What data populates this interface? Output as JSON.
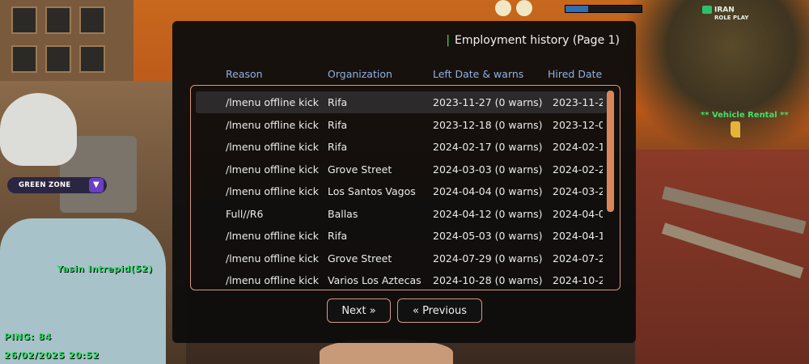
{
  "hud": {
    "brand": [
      "IRAN",
      "ROLE PLAY"
    ],
    "health_fraction": 0.3,
    "vehicle_rental_label": "**  Vehicle Rental **",
    "zone_label": "GREEN ZONE",
    "player_name": "Yasin Intrepid(52)",
    "ping": "PING: 84",
    "datetime": "26/02/2025 20:52"
  },
  "dialog": {
    "title": "Employment history (Page 1)",
    "columns": [
      "Reason",
      "Organization",
      "Left Date & warns",
      "Hired Date"
    ],
    "rows": [
      {
        "reason": "/lmenu offline kick",
        "organization": "Rifa",
        "left": "2023-11-27 (0 warns)",
        "hired": "2023-11-2"
      },
      {
        "reason": "/lmenu offline kick",
        "organization": "Rifa",
        "left": "2023-12-18 (0 warns)",
        "hired": "2023-12-0"
      },
      {
        "reason": "/lmenu offline kick",
        "organization": "Rifa",
        "left": "2024-02-17 (0 warns)",
        "hired": "2024-02-1"
      },
      {
        "reason": "/lmenu offline kick",
        "organization": "Grove Street",
        "left": "2024-03-03 (0 warns)",
        "hired": "2024-02-2"
      },
      {
        "reason": "/lmenu offline kick",
        "organization": "Los Santos Vagos",
        "left": "2024-04-04 (0 warns)",
        "hired": "2024-03-2"
      },
      {
        "reason": "Full//R6",
        "organization": "Ballas",
        "left": "2024-04-12 (0 warns)",
        "hired": "2024-04-0"
      },
      {
        "reason": "/lmenu offline kick",
        "organization": "Rifa",
        "left": "2024-05-03 (0 warns)",
        "hired": "2024-04-1"
      },
      {
        "reason": "/lmenu offline kick",
        "organization": "Grove Street",
        "left": "2024-07-29 (0 warns)",
        "hired": "2024-07-2"
      },
      {
        "reason": "/lmenu offline kick",
        "organization": "Varios Los Aztecas",
        "left": "2024-10-28 (0 warns)",
        "hired": "2024-10-2"
      }
    ],
    "next_label": "Next »",
    "prev_label": "« Previous"
  }
}
